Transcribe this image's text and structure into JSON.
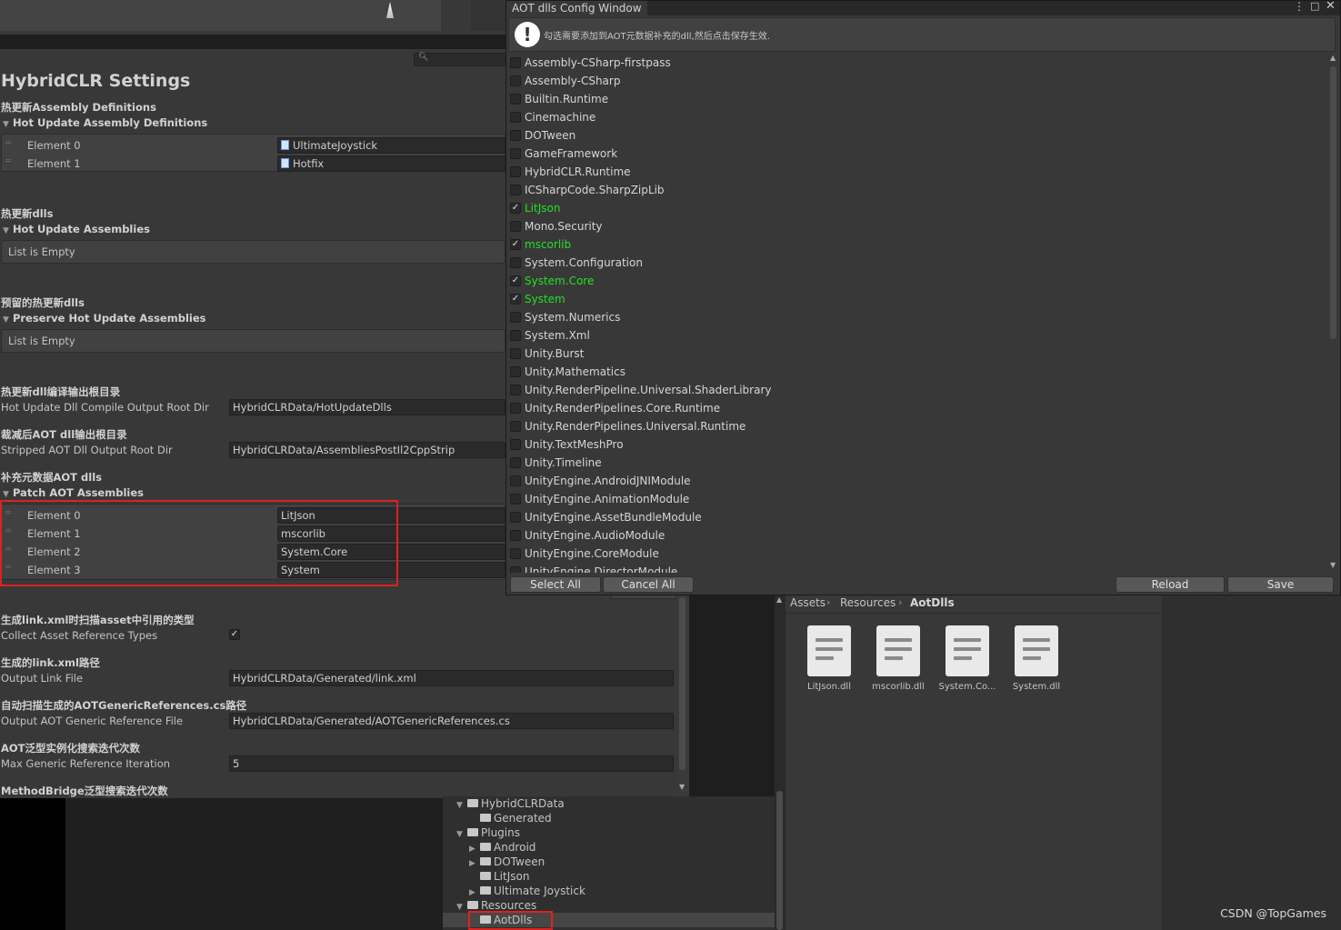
{
  "inspector": {
    "title": "HybridCLR Settings",
    "section_hot_asmdef_cn": "热更新Assembly Definitions",
    "section_hot_asmdef_label": "Hot Update Assembly Definitions",
    "hot_asmdef_elements": [
      {
        "label": "Element 0",
        "value": "UltimateJoystick"
      },
      {
        "label": "Element 1",
        "value": "Hotfix"
      }
    ],
    "section_hot_dlls_cn": "热更新dlls",
    "section_hot_dlls_label": "Hot Update Assemblies",
    "hot_dlls_empty": "List is Empty",
    "section_preserve_cn": "预留的热更新dlls",
    "section_preserve_label": "Preserve Hot Update Assemblies",
    "preserve_empty": "List is Empty",
    "compile_output_cn": "热更新dll编译输出根目录",
    "compile_output_label": "Hot Update Dll Compile Output Root Dir",
    "compile_output_value": "HybridCLRData/HotUpdateDlls",
    "stripped_cn": "裁减后AOT dll输出根目录",
    "stripped_label": "Stripped AOT Dll Output Root Dir",
    "stripped_value": "HybridCLRData/AssembliesPostIl2CppStrip",
    "patch_cn": "补充元数据AOT dlls",
    "patch_label": "Patch AOT Assemblies",
    "patch_elements": [
      {
        "label": "Element 0",
        "value": "LitJson"
      },
      {
        "label": "Element 1",
        "value": "mscorlib"
      },
      {
        "label": "Element 2",
        "value": "System.Core"
      },
      {
        "label": "Element 3",
        "value": "System"
      }
    ],
    "collect_cn": "生成link.xml时扫描asset中引用的类型",
    "collect_label": "Collect Asset Reference Types",
    "collect_checked": true,
    "link_cn": "生成的link.xml路径",
    "link_label": "Output Link File",
    "link_value": "HybridCLRData/Generated/link.xml",
    "aotgen_cn": "自动扫描生成的AOTGenericReferences.cs路径",
    "aotgen_label": "Output AOT Generic Reference File",
    "aotgen_value": "HybridCLRData/Generated/AOTGenericReferences.cs",
    "iter_cn": "AOT泛型实例化搜索迭代次数",
    "iter_label": "Max Generic Reference Iteration",
    "iter_value": "5",
    "methodbridge_cn": "MethodBridge泛型搜索迭代次数"
  },
  "aot_window": {
    "title": "AOT dlls Config Window",
    "info": "勾选需要添加到AOT元数据补充的dll,然后点击保存生效.",
    "assemblies": [
      {
        "name": "Assembly-CSharp-firstpass",
        "checked": false
      },
      {
        "name": "Assembly-CSharp",
        "checked": false
      },
      {
        "name": "Builtin.Runtime",
        "checked": false
      },
      {
        "name": "Cinemachine",
        "checked": false
      },
      {
        "name": "DOTween",
        "checked": false
      },
      {
        "name": "GameFramework",
        "checked": false
      },
      {
        "name": "HybridCLR.Runtime",
        "checked": false
      },
      {
        "name": "ICSharpCode.SharpZipLib",
        "checked": false
      },
      {
        "name": "LitJson",
        "checked": true
      },
      {
        "name": "Mono.Security",
        "checked": false
      },
      {
        "name": "mscorlib",
        "checked": true
      },
      {
        "name": "System.Configuration",
        "checked": false
      },
      {
        "name": "System.Core",
        "checked": true
      },
      {
        "name": "System",
        "checked": true
      },
      {
        "name": "System.Numerics",
        "checked": false
      },
      {
        "name": "System.Xml",
        "checked": false
      },
      {
        "name": "Unity.Burst",
        "checked": false
      },
      {
        "name": "Unity.Mathematics",
        "checked": false
      },
      {
        "name": "Unity.RenderPipeline.Universal.ShaderLibrary",
        "checked": false
      },
      {
        "name": "Unity.RenderPipelines.Core.Runtime",
        "checked": false
      },
      {
        "name": "Unity.RenderPipelines.Universal.Runtime",
        "checked": false
      },
      {
        "name": "Unity.TextMeshPro",
        "checked": false
      },
      {
        "name": "Unity.Timeline",
        "checked": false
      },
      {
        "name": "UnityEngine.AndroidJNIModule",
        "checked": false
      },
      {
        "name": "UnityEngine.AnimationModule",
        "checked": false
      },
      {
        "name": "UnityEngine.AssetBundleModule",
        "checked": false
      },
      {
        "name": "UnityEngine.AudioModule",
        "checked": false
      },
      {
        "name": "UnityEngine.CoreModule",
        "checked": false
      },
      {
        "name": "UnityEngine.DirectorModule",
        "checked": false
      }
    ],
    "select_all": "Select All",
    "cancel_all": "Cancel All",
    "reload": "Reload",
    "save": "Save",
    "check_color": "#25e025"
  },
  "project": {
    "breadcrumb": [
      "Assets",
      "Resources",
      "AotDlls"
    ],
    "tree": [
      {
        "label": "HybridCLRData",
        "indent": 0,
        "arrow": "▼",
        "open": true
      },
      {
        "label": "Generated",
        "indent": 1,
        "arrow": "",
        "open": false
      },
      {
        "label": "Plugins",
        "indent": 0,
        "arrow": "▼",
        "open": true
      },
      {
        "label": "Android",
        "indent": 1,
        "arrow": "▶",
        "open": false
      },
      {
        "label": "DOTween",
        "indent": 1,
        "arrow": "▶",
        "open": false
      },
      {
        "label": "LitJson",
        "indent": 1,
        "arrow": "",
        "open": false
      },
      {
        "label": "Ultimate Joystick",
        "indent": 1,
        "arrow": "▶",
        "open": false
      },
      {
        "label": "Resources",
        "indent": 0,
        "arrow": "▼",
        "open": true
      },
      {
        "label": "AotDlls",
        "indent": 1,
        "arrow": "",
        "open": false
      }
    ],
    "files": [
      "LitJson.dll",
      "mscorlib.dll",
      "System.Co...",
      "System.dll"
    ]
  },
  "watermark": "CSDN @TopGames"
}
